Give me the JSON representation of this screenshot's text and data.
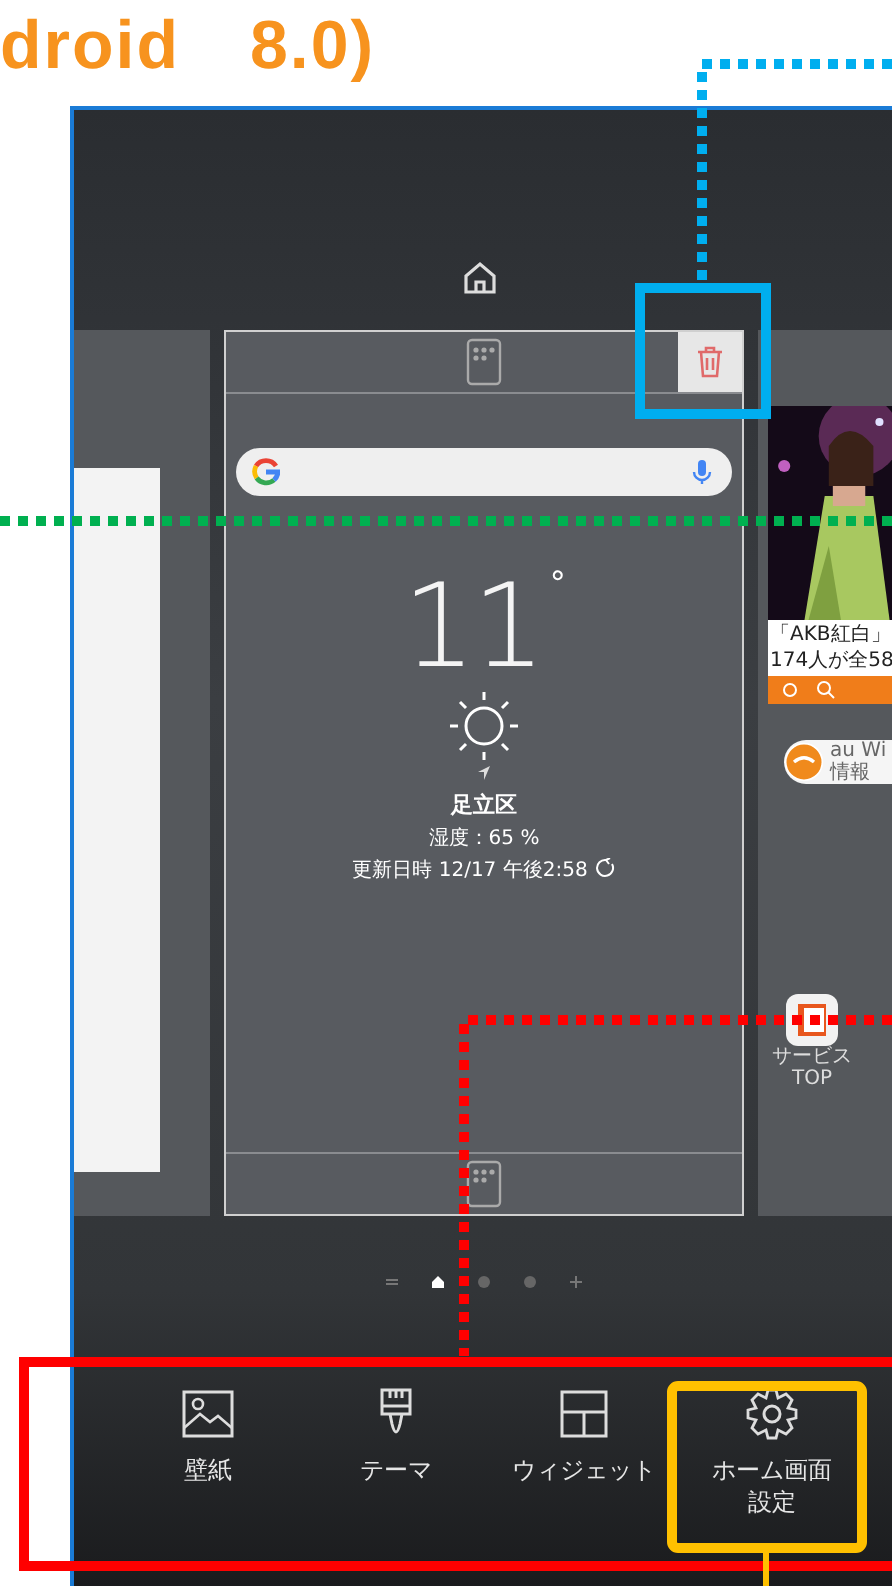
{
  "heading": "droid　8.0)",
  "weather": {
    "temperature": "11",
    "degree": "°",
    "location": "足立区",
    "humidity": "湿度：65 %",
    "updated": "更新日時 12/17 午後2:58"
  },
  "news": {
    "lines": [
      "「AKB紅白」",
      "174人が全58"
    ]
  },
  "au_widget": {
    "lines": [
      "au Wi",
      "情報"
    ]
  },
  "app": {
    "label_lines": [
      "サービス",
      "TOP"
    ]
  },
  "page_indicator": [
    {
      "kind": "menu",
      "selected": false
    },
    {
      "kind": "home",
      "selected": true
    },
    {
      "kind": "dot",
      "selected": false
    },
    {
      "kind": "dot",
      "selected": false
    },
    {
      "kind": "add",
      "selected": false
    }
  ],
  "bottom_bar": [
    {
      "kind": "wallpaper",
      "label": "壁紙"
    },
    {
      "kind": "theme",
      "label": "テーマ"
    },
    {
      "kind": "widget",
      "label": "ウィジェット"
    },
    {
      "kind": "settings",
      "label": "ホーム画面設定"
    }
  ],
  "annotations": [
    {
      "kind": "callout",
      "color": "#00aeef"
    },
    {
      "kind": "guide",
      "color": "#00b050"
    },
    {
      "kind": "frame",
      "color": "#ff0000"
    },
    {
      "kind": "highlight",
      "color": "#ffc000"
    }
  ]
}
